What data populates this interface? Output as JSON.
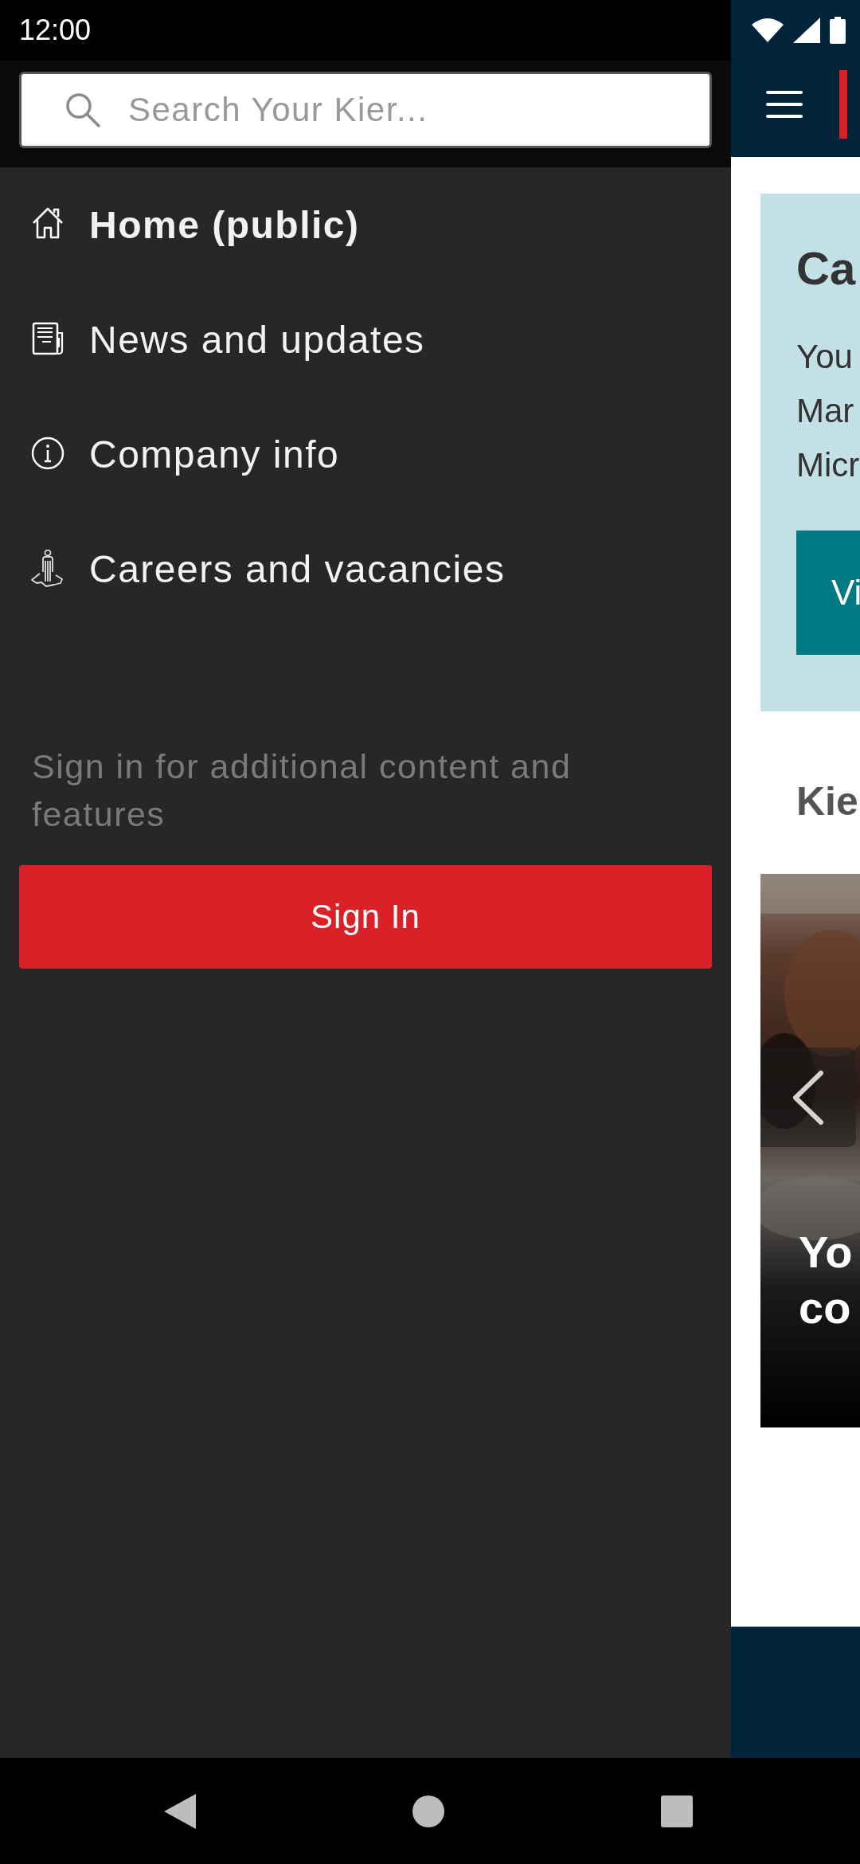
{
  "status_bar": {
    "time": "12:00"
  },
  "search": {
    "placeholder": "Search Your Kier..."
  },
  "menu": [
    {
      "label": "Home (public)",
      "selected": true
    },
    {
      "label": "News and updates",
      "selected": false
    },
    {
      "label": "Company info",
      "selected": false
    },
    {
      "label": "Careers and vacancies",
      "selected": false
    }
  ],
  "sign_in": {
    "prompt": "Sign in for additional content and features",
    "button": "Sign In"
  },
  "background_page": {
    "card": {
      "title": "Ca",
      "lines": [
        "You",
        "Mar",
        "Micr"
      ],
      "button": "Vi"
    },
    "section_title": "Kie",
    "carousel": {
      "caption_lines": [
        "Yo",
        "co"
      ]
    }
  }
}
